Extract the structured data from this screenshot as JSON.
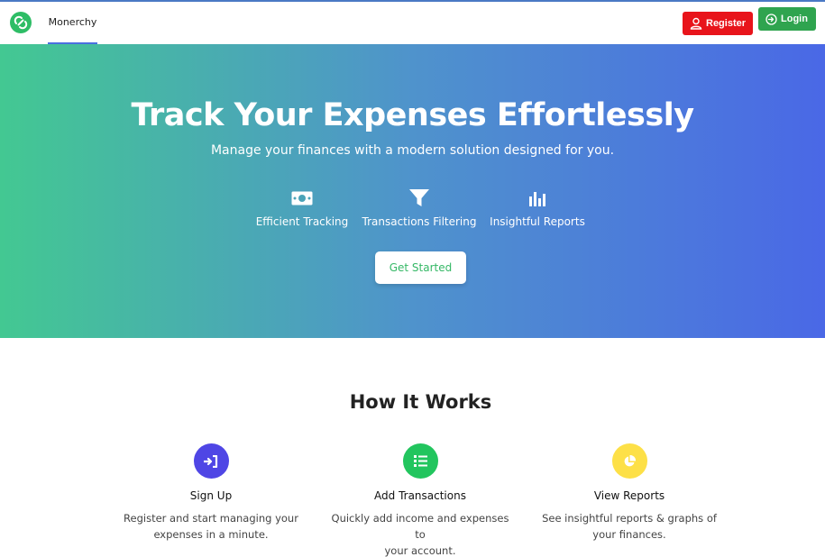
{
  "nav": {
    "brand": "Monerchy",
    "register_label": "Register",
    "login_label": "Login"
  },
  "hero": {
    "title": "Track Your Expenses Effortlessly",
    "subtitle": "Manage your finances with a modern solution designed for you.",
    "features": [
      {
        "label": "Efficient Tracking",
        "icon": "money-bill-icon"
      },
      {
        "label": "Transactions Filtering",
        "icon": "filter-icon"
      },
      {
        "label": "Insightful Reports",
        "icon": "bar-chart-icon"
      }
    ],
    "cta_label": "Get Started"
  },
  "how": {
    "title": "How It Works",
    "steps": [
      {
        "title": "Sign Up",
        "desc_line1": "Register and start managing your",
        "desc_line2": "expenses in a minute.",
        "icon": "sign-in-icon",
        "color": "#4f46e5"
      },
      {
        "title": "Add Transactions",
        "desc_line1": "Quickly add income and expenses to",
        "desc_line2": "your account.",
        "icon": "list-icon",
        "color": "#22c55e"
      },
      {
        "title": "View Reports",
        "desc_line1": "See insightful reports & graphs of",
        "desc_line2": "your finances.",
        "icon": "pie-chart-icon",
        "color": "#fde047"
      }
    ]
  },
  "colors": {
    "hero_gradient_start": "#43c892",
    "hero_gradient_end": "#4a68e6",
    "register_button": "#e8141b",
    "login_button": "#2fa44f",
    "cta_text": "#35b866"
  }
}
